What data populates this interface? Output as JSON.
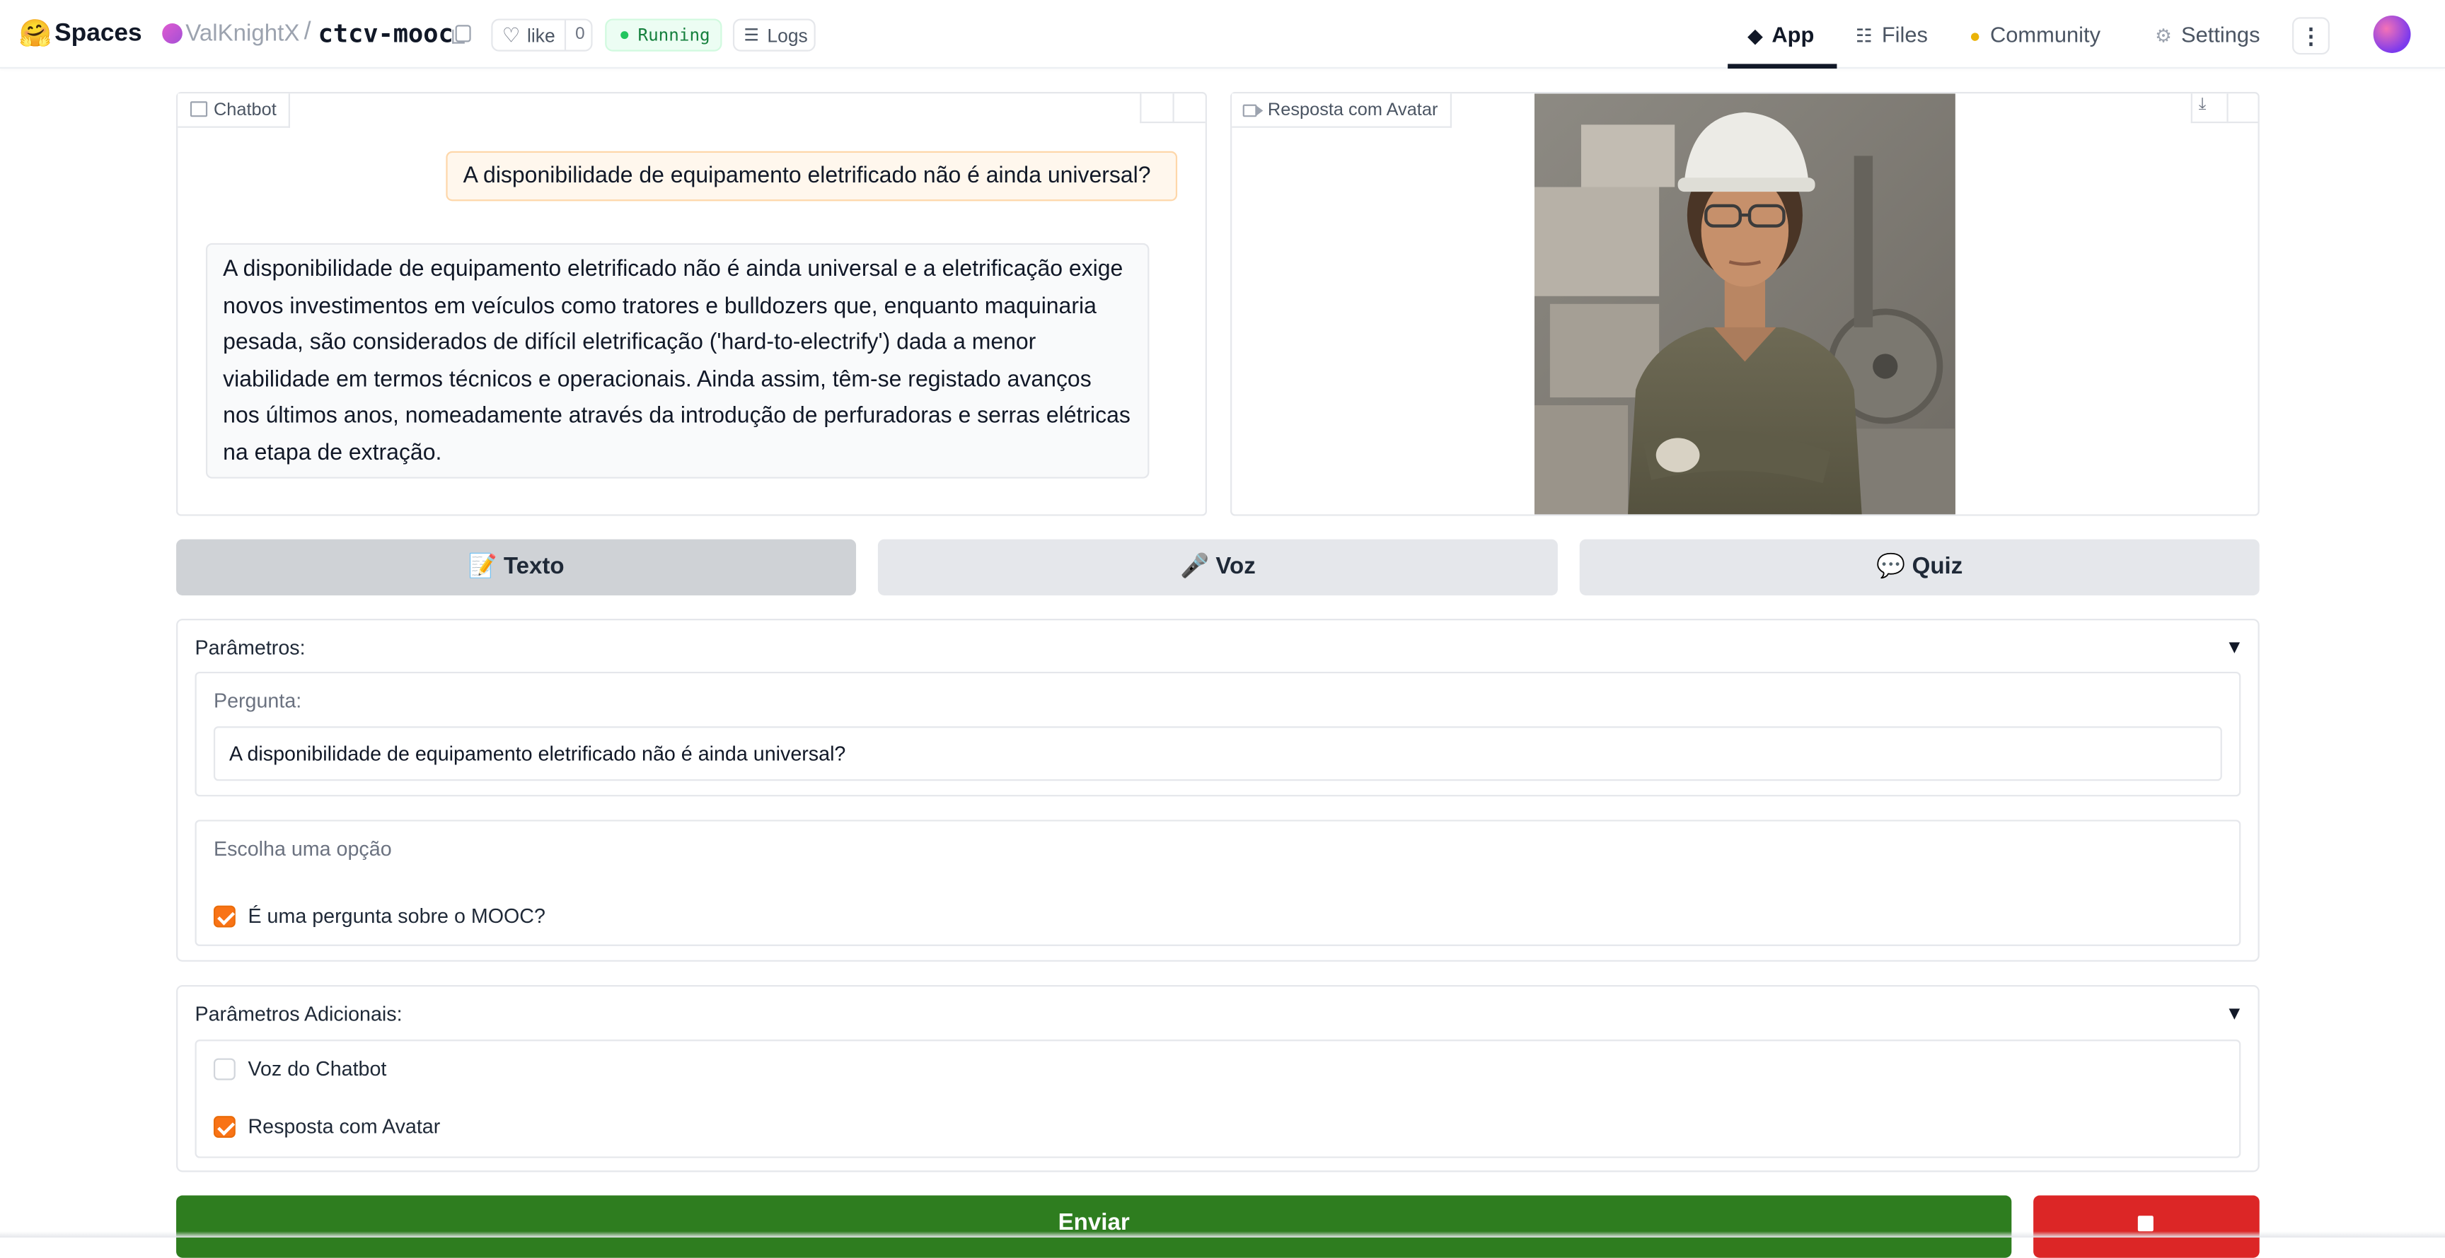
{
  "nav": {
    "logo_emoji": "🤗",
    "spaces_label": "Spaces",
    "owner": "ValKnightX",
    "slash": "/",
    "repo": "ctcv-mooc",
    "like_label": "like",
    "like_count": "0",
    "status": "Running",
    "logs_label": "Logs",
    "tabs": {
      "app": "App",
      "files": "Files",
      "community": "Community",
      "settings": "Settings"
    },
    "more_label": "⋮"
  },
  "chatbot": {
    "label": "Chatbot",
    "user_message": "A disponibilidade de equipamento eletrificado não é ainda universal?",
    "bot_message": "A disponibilidade de equipamento eletrificado não é ainda universal e a eletrificação exige novos investimentos em veículos como tratores e bulldozers que, enquanto maquinaria pesada, são considerados de difícil eletrificação ('hard-to-electrify') dada a menor viabilidade em termos técnicos e operacionais. Ainda assim, têm-se registado avanços nos últimos anos, nomeadamente através da introdução de perfuradoras e serras elétricas na etapa de extração."
  },
  "avatar_panel": {
    "label": "Resposta com Avatar"
  },
  "modes": {
    "texto": "📝 Texto",
    "voz": "🎤 Voz",
    "quiz": "💬 Quiz"
  },
  "params": {
    "title": "Parâmetros:",
    "caret": "▼",
    "question_label": "Pergunta:",
    "question_value": "A disponibilidade de equipamento eletrificado não é ainda universal?",
    "option_label": "Escolha uma opção",
    "mooc_checkbox_label": "É uma pergunta sobre o MOOC?",
    "mooc_checked": true
  },
  "extra_params": {
    "title": "Parâmetros Adicionais:",
    "caret": "▼",
    "voice_label": "Voz do Chatbot",
    "voice_checked": false,
    "avatar_label": "Resposta com Avatar",
    "avatar_checked": true
  },
  "actions": {
    "send_label": "Enviar"
  },
  "colors": {
    "accent_orange": "#f97316",
    "send_green": "#2e7d1f",
    "stop_red": "#dc2626"
  }
}
